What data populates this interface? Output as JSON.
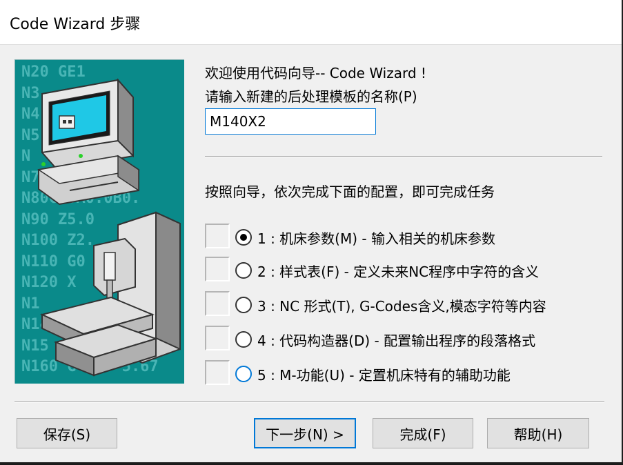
{
  "window": {
    "title": "Code Wizard 步骤"
  },
  "illustration": {
    "gcode_lines": [
      "N20 GE1",
      "N3     M09",
      "N4",
      "N5",
      "N      37",
      "N7     0H1",
      "N80G00A0.0B0.",
      "N90 Z5.0",
      "N100 Z2.",
      "N110 G0",
      "N120 X",
      "N1",
      "N14",
      "N15",
      "N160 G    -5.67"
    ]
  },
  "intro": {
    "welcome": "欢迎使用代码向导-- Code Wizard !",
    "prompt": "请输入新建的后处理模板的名称(P)",
    "template_name_value": "M140X2"
  },
  "instruction": "按照向导，依次完成下面的配置，即可完成任务",
  "steps": [
    {
      "label": "1 : 机床参数(M) - 输入相关的机床参数",
      "selected": true
    },
    {
      "label": "2 : 样式表(F) - 定义未来NC程序中字符的含义",
      "selected": false
    },
    {
      "label": "3 : NC 形式(T), G-Codes含义,模态字符等内容",
      "selected": false
    },
    {
      "label": "4 : 代码构造器(D) - 配置输出程序的段落格式",
      "selected": false
    },
    {
      "label": "5 : M-功能(U) - 定置机床特有的辅助功能",
      "selected": false
    }
  ],
  "buttons": {
    "save": "保存(S)",
    "next": "下一步(N) >",
    "finish": "完成(F)",
    "help": "帮助(H)"
  },
  "colors": {
    "illustration_bg": "#0a8a8a",
    "focus_accent": "#0078d7"
  }
}
